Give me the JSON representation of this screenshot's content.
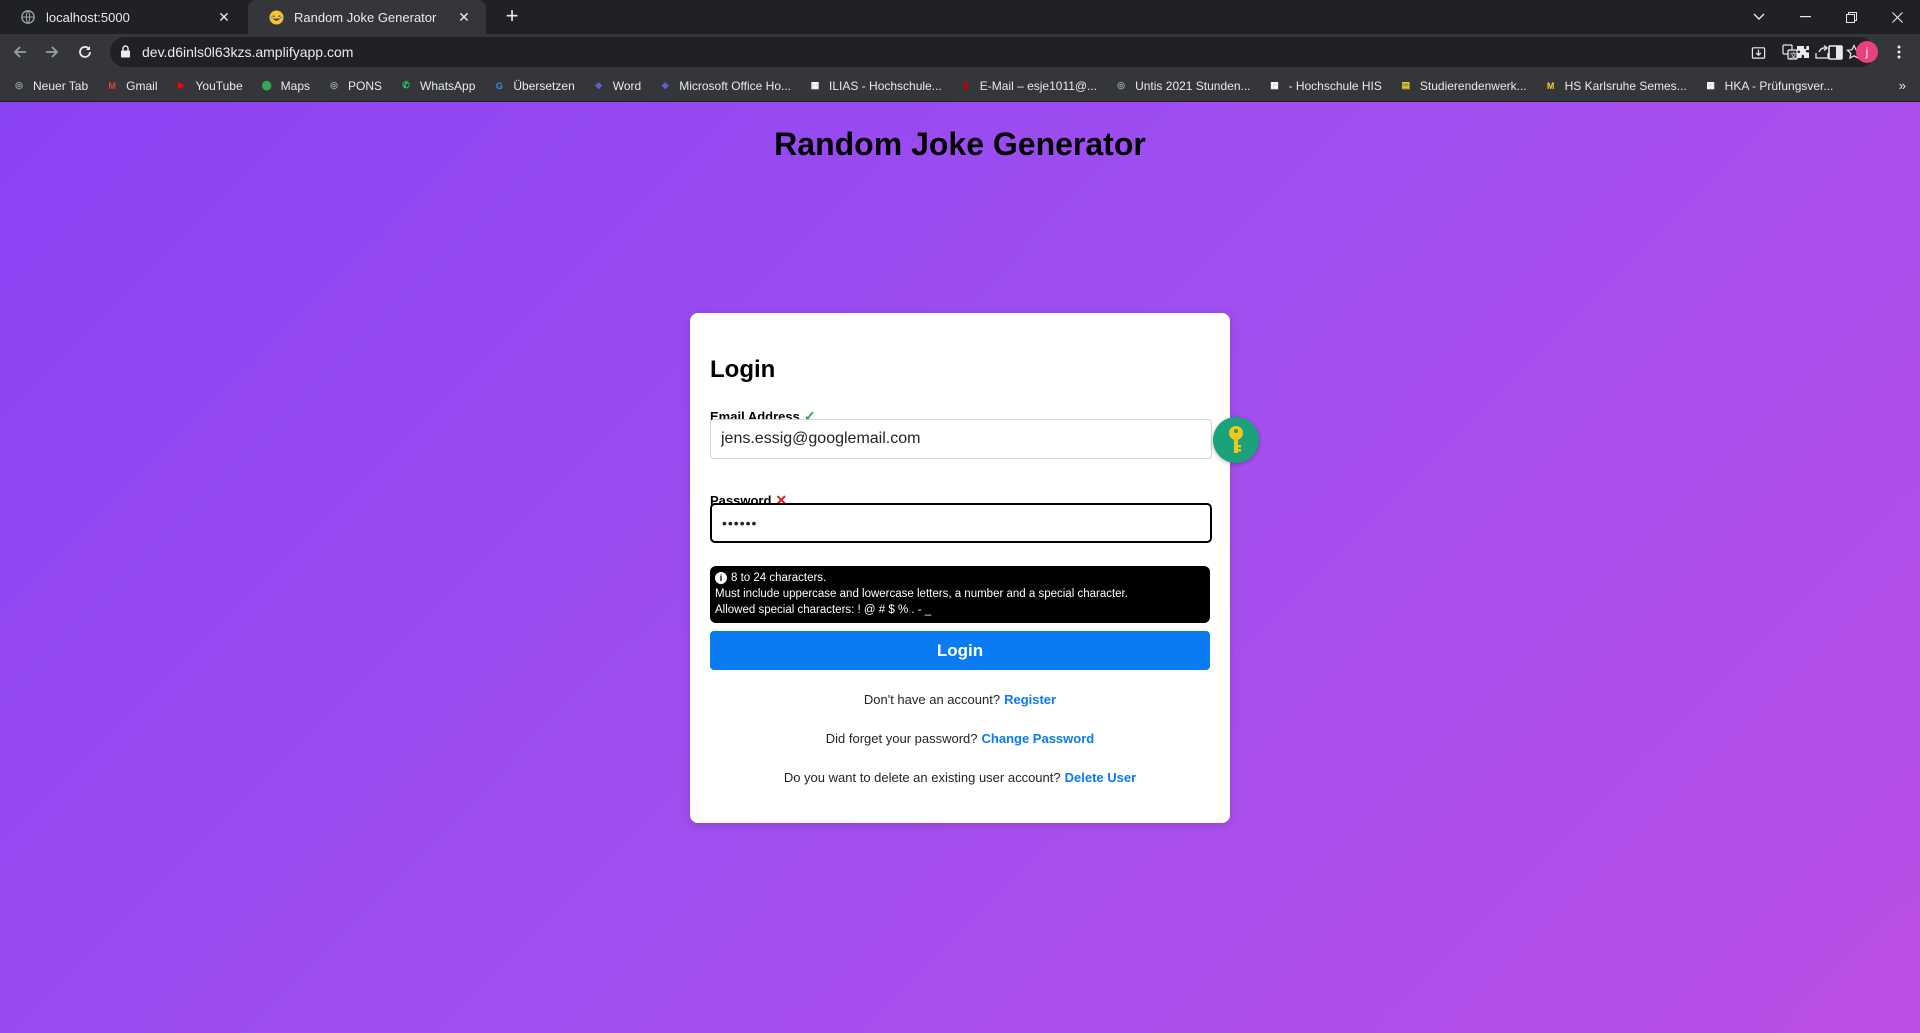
{
  "browser": {
    "tabs": [
      {
        "title": "localhost:5000",
        "icon": "globe-icon",
        "active": false
      },
      {
        "title": "Random Joke Generator",
        "icon": "laughing-emoji-icon",
        "active": true
      }
    ],
    "url": "dev.d6inls0l63kzs.amplifyapp.com",
    "bookmarks": [
      {
        "label": "Neuer Tab",
        "icon": "globe-icon",
        "color": "#9aa0a6"
      },
      {
        "label": "Gmail",
        "icon": "gmail-icon",
        "color": "#ea4335"
      },
      {
        "label": "YouTube",
        "icon": "youtube-icon",
        "color": "#ff0000"
      },
      {
        "label": "Maps",
        "icon": "maps-icon",
        "color": "#34a853"
      },
      {
        "label": "PONS",
        "icon": "globe-icon",
        "color": "#9aa0a6"
      },
      {
        "label": "WhatsApp",
        "icon": "whatsapp-icon",
        "color": "#25d366"
      },
      {
        "label": "Übersetzen",
        "icon": "translate-icon",
        "color": "#4285f4"
      },
      {
        "label": "Word",
        "icon": "word-icon",
        "color": "#5b5fc7"
      },
      {
        "label": "Microsoft Office Ho...",
        "icon": "office-icon",
        "color": "#5b5fc7"
      },
      {
        "label": "ILIAS - Hochschule...",
        "icon": "hka-icon",
        "color": "#ffffff"
      },
      {
        "label": "E-Mail – esje1011@...",
        "icon": "mail-icon",
        "color": "#c00000"
      },
      {
        "label": "Untis 2021 Stunden...",
        "icon": "globe-icon",
        "color": "#9aa0a6"
      },
      {
        "label": "- Hochschule HIS",
        "icon": "hka-icon",
        "color": "#ffffff"
      },
      {
        "label": "Studierendenwerk...",
        "icon": "studierendenwerk-icon",
        "color": "#f6d32d"
      },
      {
        "label": "HS Karlsruhe Semes...",
        "icon": "hs-karlsruhe-icon",
        "color": "#f6d32d"
      },
      {
        "label": "HKA - Prüfungsver...",
        "icon": "hka-icon",
        "color": "#ffffff"
      }
    ],
    "bookmarks_more": "»",
    "avatar_initial": "j"
  },
  "page": {
    "title": "Random Joke Generator",
    "login": {
      "heading": "Login",
      "email_label": "Email Address",
      "email_status": "✓",
      "email_value": "jens.essig@googlemail.com",
      "password_label": "Password",
      "password_status": "✕",
      "password_value": "••••••",
      "hint_lines": [
        "8 to 24 characters.",
        "Must include uppercase and lowercase letters, a number and a special character.",
        "Allowed special characters: ! @ # $ % . - _"
      ],
      "button_label": "Login",
      "register_prompt": "Don't have an account?",
      "register_link": "Register",
      "forgot_prompt": "Did forget your password?",
      "forgot_link": "Change Password",
      "delete_prompt": "Do you want to delete an existing user account?",
      "delete_link": "Delete User"
    }
  }
}
